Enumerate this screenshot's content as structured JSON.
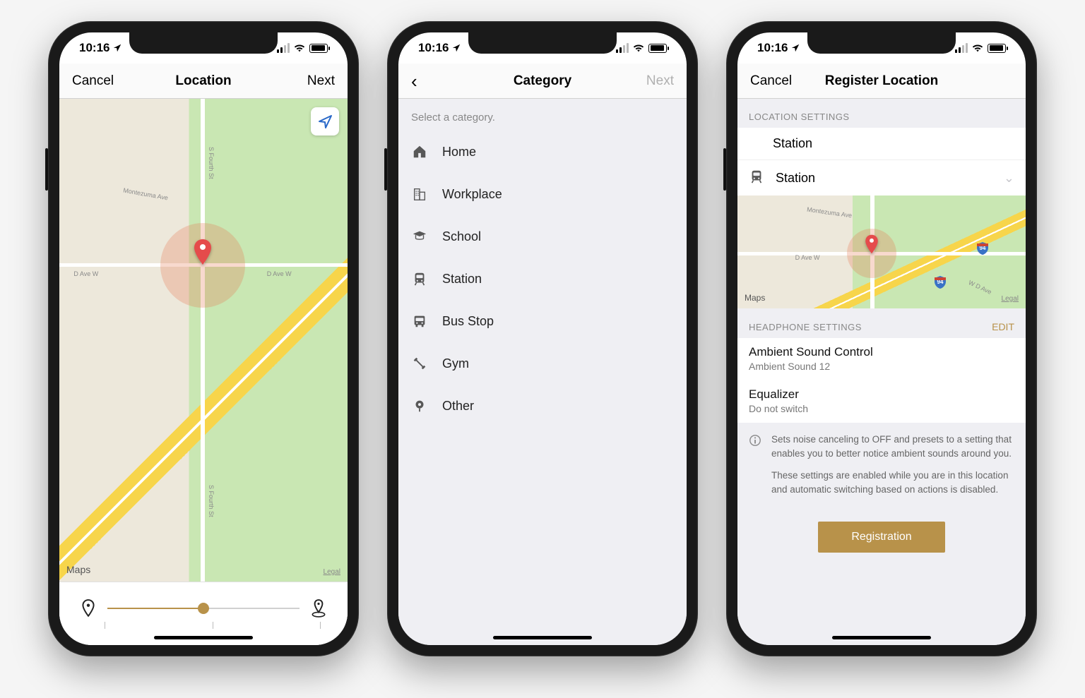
{
  "status": {
    "time": "10:16"
  },
  "screen1": {
    "nav_left": "Cancel",
    "nav_title": "Location",
    "nav_right": "Next",
    "maps_attr": "Maps",
    "legal": "Legal",
    "roads": {
      "v_label_top": "S Fourth St",
      "v_label_bottom": "S Fourth St",
      "h_left": "D Ave W",
      "h_right": "D Ave W",
      "mont": "Montezuma Ave"
    }
  },
  "screen2": {
    "nav_title": "Category",
    "nav_right": "Next",
    "hint": "Select a category.",
    "items": [
      {
        "icon": "home",
        "label": "Home"
      },
      {
        "icon": "workplace",
        "label": "Workplace"
      },
      {
        "icon": "school",
        "label": "School"
      },
      {
        "icon": "station",
        "label": "Station"
      },
      {
        "icon": "bus",
        "label": "Bus Stop"
      },
      {
        "icon": "gym",
        "label": "Gym"
      },
      {
        "icon": "other",
        "label": "Other"
      }
    ]
  },
  "screen3": {
    "nav_left": "Cancel",
    "nav_title": "Register Location",
    "section_location": "LOCATION SETTINGS",
    "loc_name": "Station",
    "loc_type": "Station",
    "maps_attr": "Maps",
    "legal": "Legal",
    "roads": {
      "h_left": "D Ave W",
      "mont": "Montezuma Ave",
      "hwy": "94",
      "wd": "W D Ave"
    },
    "section_headphone": "HEADPHONE SETTINGS",
    "edit": "EDIT",
    "hp1_title": "Ambient Sound Control",
    "hp1_sub": "Ambient Sound 12",
    "hp2_title": "Equalizer",
    "hp2_sub": "Do not switch",
    "info1": "Sets noise canceling to OFF and presets to a setting that enables you to better notice ambient sounds around you.",
    "info2": "These settings are enabled while you are in this location and automatic switching based on actions is disabled.",
    "button": "Registration"
  }
}
